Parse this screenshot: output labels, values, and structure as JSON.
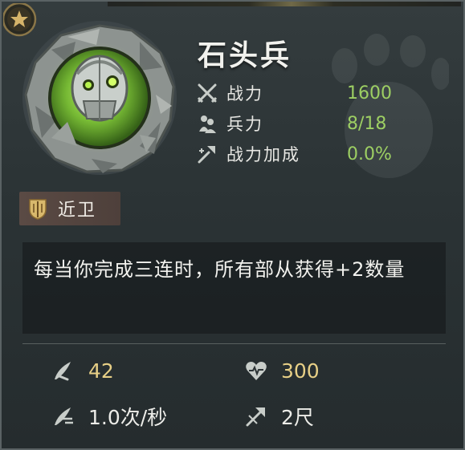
{
  "unit": {
    "name": "石头兵",
    "portrait_icon": "stone-golem-portrait",
    "rank_icon": "star-icon"
  },
  "stats": [
    {
      "label": "战力",
      "value": "1600",
      "icon": "crossed-swords-icon"
    },
    {
      "label": "兵力",
      "value": "8/18",
      "icon": "troops-icon"
    },
    {
      "label": "战力加成",
      "value": "0.0%",
      "icon": "power-up-icon"
    }
  ],
  "class_tag": {
    "label": "近卫",
    "icon": "guard-shield-icon"
  },
  "description": "每当你完成三连时，所有部从获得+2数量",
  "attributes": [
    {
      "value": "42",
      "icon": "attack-icon",
      "tone": "gold"
    },
    {
      "value": "300",
      "icon": "heart-icon",
      "tone": "gold"
    },
    {
      "value": "1.0次/秒",
      "icon": "attack-speed-icon",
      "tone": "white"
    },
    {
      "value": "2尺",
      "icon": "range-icon",
      "tone": "white"
    }
  ],
  "colors": {
    "stat_value": "#9dcf63",
    "gold_value": "#e7cf86",
    "tag_bg": "#5a4a44",
    "portrait_green": "#7ec23a"
  }
}
